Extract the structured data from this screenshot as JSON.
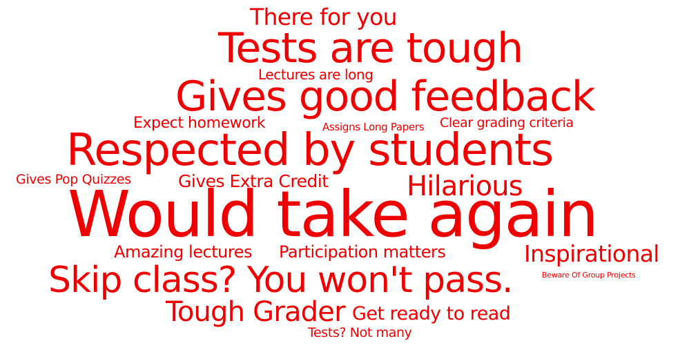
{
  "accent_color": "#ee0000",
  "background_color": "#ffffff",
  "tags": [
    "There for you",
    "Tests are tough",
    "Lectures are long",
    "Gives good feedback",
    "Expect homework",
    "Assigns Long Papers",
    "Clear grading criteria",
    "Respected by students",
    "Gives Pop Quizzes",
    "Gives Extra Credit",
    "Hilarious",
    "Would take again",
    "Amazing lectures",
    "Participation matters",
    "Inspirational",
    "Beware Of Group Projects",
    "Skip class? You won't pass.",
    "Tough Grader",
    "Get ready to read",
    "Tests? Not many"
  ]
}
